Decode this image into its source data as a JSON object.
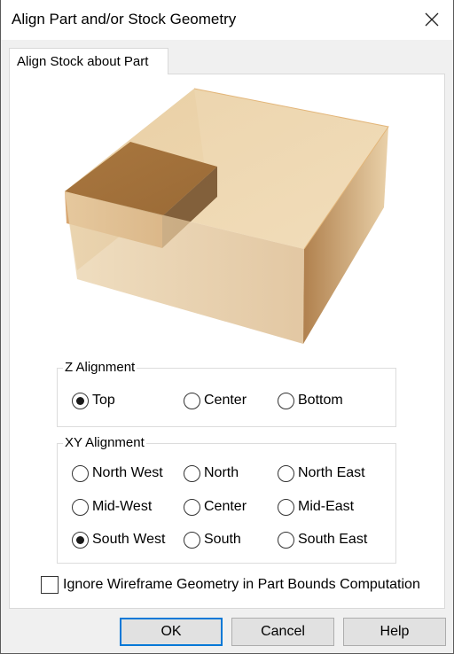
{
  "window": {
    "title": "Align Part and/or Stock Geometry"
  },
  "tabs": [
    {
      "label": "Align Stock about Part",
      "active": true
    }
  ],
  "z_alignment": {
    "label": "Z Alignment",
    "options": [
      {
        "label": "Top",
        "selected": true
      },
      {
        "label": "Center",
        "selected": false
      },
      {
        "label": "Bottom",
        "selected": false
      }
    ]
  },
  "xy_alignment": {
    "label": "XY Alignment",
    "options": [
      {
        "label": "North West",
        "selected": false
      },
      {
        "label": "North",
        "selected": false
      },
      {
        "label": "North East",
        "selected": false
      },
      {
        "label": "Mid-West",
        "selected": false
      },
      {
        "label": "Center",
        "selected": false
      },
      {
        "label": "Mid-East",
        "selected": false
      },
      {
        "label": "South West",
        "selected": true
      },
      {
        "label": "South",
        "selected": false
      },
      {
        "label": "South East",
        "selected": false
      }
    ]
  },
  "ignore_wireframe": {
    "label": "Ignore Wireframe Geometry in Part Bounds Computation",
    "checked": false
  },
  "buttons": {
    "ok": "OK",
    "cancel": "Cancel",
    "help": "Help"
  },
  "colors": {
    "accent": "#0078d7",
    "stock": "#e8c48e",
    "part": "#a4733d"
  }
}
